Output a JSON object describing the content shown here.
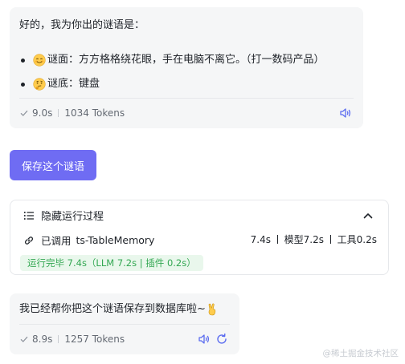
{
  "message1": {
    "intro": "好的，我为你出的谜语是：",
    "riddle_label": "谜面：",
    "riddle_text": "方方格格绕花眼，手在电脑不离它。（打一数码产品）",
    "answer_label": "谜底：",
    "answer_text": "键盘",
    "duration": "9.0s",
    "tokens": "1034 Tokens"
  },
  "save_button": {
    "label": "保存这个谜语"
  },
  "process": {
    "toggle_label": "隐藏运行过程",
    "tool_prefix": "已调用",
    "tool_name": "ts-TableMemory",
    "timing_total": "7.4s",
    "timing_model": "模型7.2s",
    "timing_tool": "工具0.2s",
    "status": "运行完毕 7.4s（LLM 7.2s | 插件 0.2s）"
  },
  "message2": {
    "text": "我已经帮你把这个谜语保存到数据库啦~",
    "duration": "8.9s",
    "tokens": "1257 Tokens"
  },
  "watermark": "@稀土掘金技术社区",
  "icons": {
    "check": "check-icon",
    "speaker": "speaker-icon",
    "list": "list-icon",
    "chevron": "chevron-up-icon",
    "link": "link-icon",
    "refresh": "refresh-icon",
    "emoji_smile": "smiling-face-emoji",
    "emoji_thinking": "thinking-face-emoji",
    "emoji_hand": "victory-hand-emoji"
  },
  "colors": {
    "accent": "#6f6cf3",
    "card_bg": "#f5f6f7",
    "status_bg": "#e9f7ec",
    "status_text": "#34a853",
    "icon_blue": "#5b6cf0"
  }
}
